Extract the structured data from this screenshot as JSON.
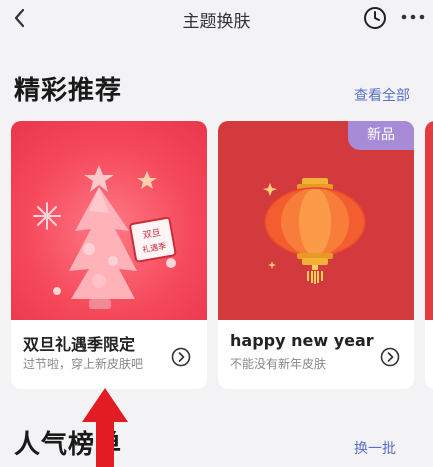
{
  "header": {
    "title": "主题换肤"
  },
  "featured": {
    "title": "精彩推荐",
    "see_all": "查看全部",
    "cards": [
      {
        "title": "双旦礼遇季限定",
        "desc": "过节啦，穿上新皮肤吧",
        "sticker": "双旦\n礼遇季"
      },
      {
        "title": "happy new year",
        "desc": "不能没有新年皮肤",
        "badge": "新品"
      }
    ]
  },
  "popular": {
    "title": "人气榜单",
    "refresh": "换一批"
  },
  "colors": {
    "accent": "#5a6fc7",
    "badge": "#a78bd6",
    "card_red": "#d33a3e"
  }
}
